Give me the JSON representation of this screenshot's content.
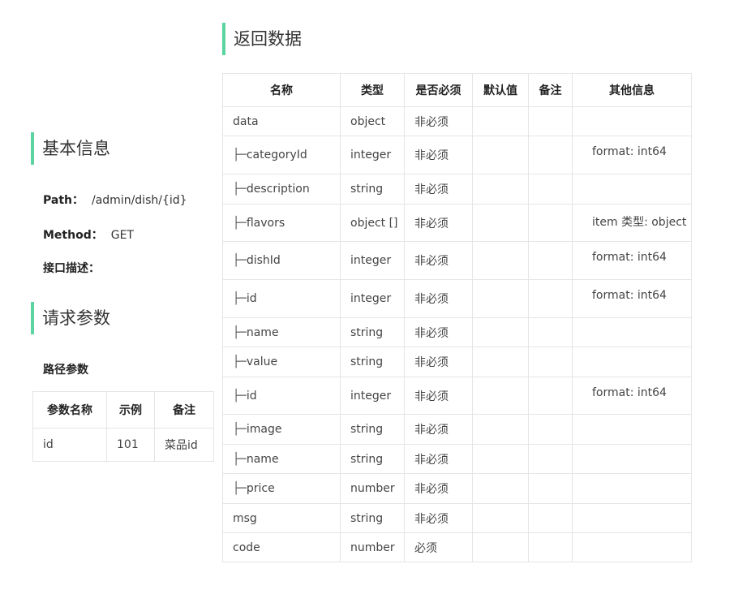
{
  "return_section": {
    "title": "返回数据"
  },
  "basic_section": {
    "title": "基本信息"
  },
  "basic": {
    "path_label": "Path：",
    "path_value": "/admin/dish/{id}",
    "method_label": "Method：",
    "method_value": "GET",
    "desc_label": "接口描述："
  },
  "request_section": {
    "title": "请求参数"
  },
  "path_params": {
    "heading": "路径参数",
    "columns": [
      "参数名称",
      "示例",
      "备注"
    ],
    "rows": [
      [
        "id",
        "101",
        "菜品id"
      ]
    ]
  },
  "return_table": {
    "columns": [
      "名称",
      "类型",
      "是否必须",
      "默认值",
      "备注",
      "其他信息"
    ],
    "rows": [
      {
        "branch": "",
        "name": "data",
        "type": "object",
        "required": "非必须",
        "other": ""
      },
      {
        "branch": "├─",
        "name": "categoryId",
        "type": "integer",
        "required": "非必须",
        "other": "format: int64"
      },
      {
        "branch": "├─",
        "name": "description",
        "type": "string",
        "required": "非必须",
        "other": ""
      },
      {
        "branch": "├─",
        "name": "flavors",
        "type": "object []",
        "required": "非必须",
        "other": "item 类型: object"
      },
      {
        "branch": "├─",
        "name": "dishId",
        "type": "integer",
        "required": "非必须",
        "other": "format: int64"
      },
      {
        "branch": "├─",
        "name": "id",
        "type": "integer",
        "required": "非必须",
        "other": "format: int64"
      },
      {
        "branch": "├─",
        "name": "name",
        "type": "string",
        "required": "非必须",
        "other": ""
      },
      {
        "branch": "├─",
        "name": "value",
        "type": "string",
        "required": "非必须",
        "other": ""
      },
      {
        "branch": "├─",
        "name": "id",
        "type": "integer",
        "required": "非必须",
        "other": "format: int64"
      },
      {
        "branch": "├─",
        "name": "image",
        "type": "string",
        "required": "非必须",
        "other": ""
      },
      {
        "branch": "├─",
        "name": "name",
        "type": "string",
        "required": "非必须",
        "other": ""
      },
      {
        "branch": "├─",
        "name": "price",
        "type": "number",
        "required": "非必须",
        "other": ""
      },
      {
        "branch": "",
        "name": "msg",
        "type": "string",
        "required": "非必须",
        "other": ""
      },
      {
        "branch": "",
        "name": "code",
        "type": "number",
        "required": "必须",
        "other": ""
      }
    ]
  },
  "colors": {
    "accent": "#5cd3a0",
    "border": "#e5e5e5",
    "text": "#333333"
  }
}
